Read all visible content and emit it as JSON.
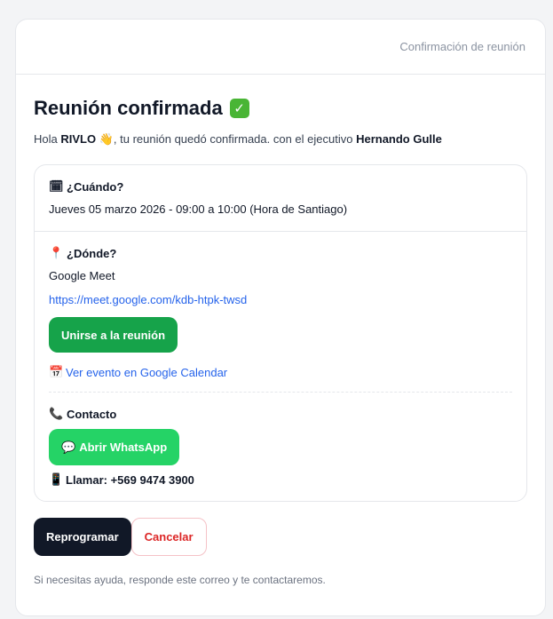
{
  "header": {
    "label": "Confirmación de reunión"
  },
  "title": "Reunión confirmada",
  "intro": {
    "prefix": "Hola ",
    "name": "RIVLO",
    "middle": ", tu reunión quedó confirmada. con el ejecutivo ",
    "executive": "Hernando Gulle"
  },
  "when": {
    "title": "¿Cuándo?",
    "value": "Jueves 05 marzo 2026 - 09:00 a 10:00 (Hora de Santiago)"
  },
  "where": {
    "title": "¿Dónde?",
    "platform": "Google Meet",
    "url": "https://meet.google.com/kdb-htpk-twsd",
    "join_label": "Unirse a la reunión",
    "calendar_label": "Ver evento en Google Calendar"
  },
  "contact": {
    "title": "Contacto",
    "whatsapp_label": "Abrir WhatsApp",
    "call_label": "Llamar: +569 9474 3900"
  },
  "actions": {
    "reschedule_label": "Reprogramar",
    "cancel_label": "Cancelar"
  },
  "footer": "Si necesitas ayuda, responde este correo y te contactaremos.",
  "icons": {
    "check": "check-mark-icon",
    "wave": "waving-hand-icon",
    "calendar": "calendar-icon",
    "pin": "location-pin-icon",
    "phone": "telephone-icon",
    "chat": "speech-bubble-icon",
    "mobile": "mobile-phone-icon"
  },
  "colors": {
    "green_button": "#16a34a",
    "whatsapp_button": "#25d366",
    "dark_button": "#111827",
    "link": "#2563eb",
    "cancel": "#dc2626"
  }
}
